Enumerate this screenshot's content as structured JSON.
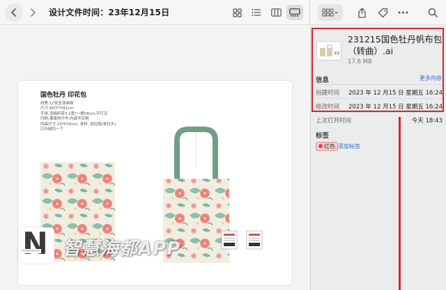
{
  "toolbar": {
    "title": "设计文件时间：23年12月15日",
    "icons": [
      "chevron-left-icon",
      "chevron-right-icon",
      "grid-view-icon",
      "list-view-icon",
      "column-view-icon",
      "gallery-view-icon",
      "group-icon",
      "share-icon",
      "tag-icon",
      "more-icon",
      "search-icon"
    ]
  },
  "preview": {
    "artboard_title": "国色牡丹 印花包",
    "specs": [
      "材质:12安全涤单面",
      "尺寸:W37*H41cm",
      "手提:涤棉织带3.2宽*一根58cm,不打叉",
      "印刷:满版热升华,内袋不印刷",
      "内袋尺寸:19*H16cm, 本料, 加拉链(单拉头)",
      "口头磁扣一个"
    ],
    "colors": {
      "pattern_bg": "#f1ede0",
      "peony": "#e58f85",
      "leaf": "#7fb6a0",
      "handle": "#6f9f86"
    }
  },
  "watermark": {
    "letter": "N",
    "small": "NewsNews",
    "text": "智慧海都APP"
  },
  "panel": {
    "filename": "231215国色牡丹帆布包（转曲）.ai",
    "filesize": "17.6 MB",
    "info_label": "信息",
    "more_label": "更多内容",
    "rows": [
      {
        "key": "创建时间",
        "value": "2023 年 12 月15 日 星期五 16:24"
      },
      {
        "key": "修改时间",
        "value": "2023 年 12 月15 日 星期五 16:24"
      },
      {
        "key": "上次打开时间",
        "value": "今天 18:43"
      }
    ],
    "tags_label": "标签",
    "tag": "红色",
    "add_tag": "添加标签",
    "colors": {
      "accent": "#2f6fd6",
      "highlight": "#d1262b",
      "tag_red": "#e2434b"
    }
  }
}
